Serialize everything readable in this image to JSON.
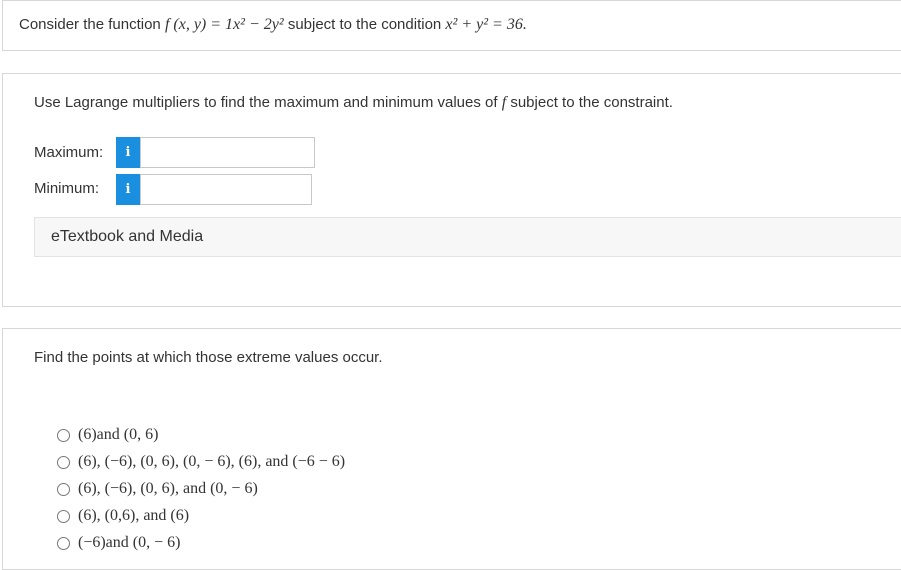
{
  "intro": {
    "lead": "Consider the function",
    "function_expr": "f (x, y) = 1x² − 2y²",
    "middle": "subject to the condition",
    "constraint_expr": "x² + y² = 36."
  },
  "part1": {
    "prompt_lead": "Use Lagrange multipliers to find the maximum and minimum values of",
    "prompt_f": "f",
    "prompt_tail": "subject to the constraint.",
    "maximum_label": "Maximum:",
    "minimum_label": "Minimum:",
    "info_icon": "info-icon",
    "info_glyph": "i",
    "maximum_value": "",
    "minimum_value": "",
    "etextbook_label": "eTextbook and Media"
  },
  "part2": {
    "prompt": "Find the points at which those extreme values occur.",
    "choices": [
      "(6)and (0, 6)",
      "(6), (−6), (0, 6), (0, − 6), (6), and (−6 − 6)",
      "(6), (−6), (0, 6), and (0, − 6)",
      "(6), (0,6), and (6)",
      "(−6)and (0, − 6)"
    ]
  },
  "colors": {
    "info_button": "#1a8fe0",
    "panel_border": "#d7d7d7",
    "etext_bg": "#f7f7f7"
  }
}
